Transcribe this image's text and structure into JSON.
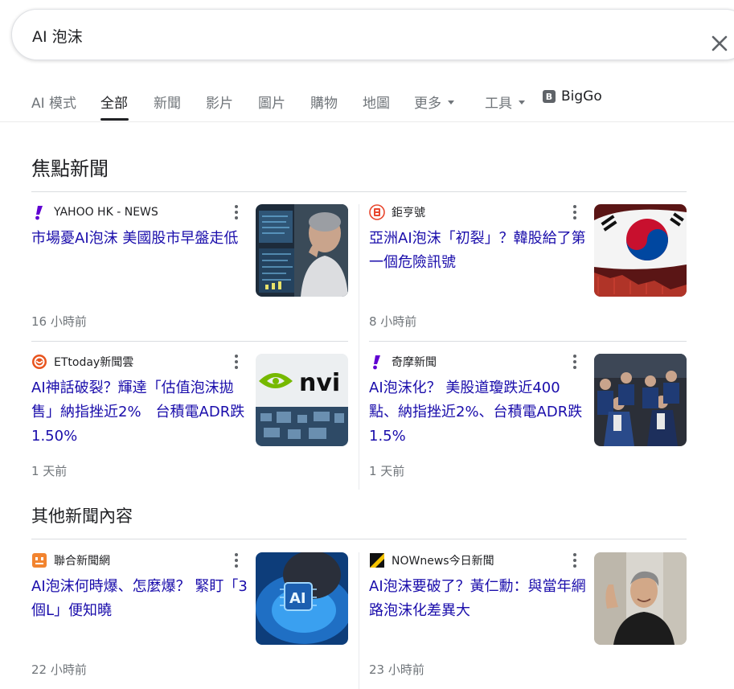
{
  "search": {
    "query": "AI 泡沫"
  },
  "tabs": [
    {
      "label": "AI 模式"
    },
    {
      "label": "全部"
    },
    {
      "label": "新聞"
    },
    {
      "label": "影片"
    },
    {
      "label": "圖片"
    },
    {
      "label": "購物"
    },
    {
      "label": "地圖"
    },
    {
      "label": "更多"
    },
    {
      "label": "工具"
    }
  ],
  "biggo": {
    "icon_letter": "B",
    "label": "BigGo"
  },
  "sections": {
    "top_stories": "焦點新聞",
    "more_news": "其他新聞內容"
  },
  "cards": [
    {
      "source": "YAHOO HK - NEWS",
      "icon": "yahoo-icon",
      "headline": "市場憂AI泡沫 美國股市早盤走低",
      "time": "16 小時前"
    },
    {
      "source": "鉅亨號",
      "icon": "cnyes-icon",
      "headline": "亞洲AI泡沫「初裂」？韓股給了第一個危險訊號",
      "time": "8 小時前"
    },
    {
      "source": "ETtoday新聞雲",
      "icon": "ettoday-icon",
      "headline": "AI神話破裂？輝達「估值泡沫拋售」納指挫近2%　台積電ADR跌1.50%",
      "time": "1 天前"
    },
    {
      "source": "奇摩新聞",
      "icon": "yahoo-icon",
      "headline": "AI泡沫化？ 美股道瓊跌近400點、納指挫近2%、台積電ADR跌1.5%",
      "time": "1 天前"
    },
    {
      "source": "聯合新聞網",
      "icon": "udn-icon",
      "headline": "AI泡沫何時爆、怎麼爆？ 緊盯「3個L」便知曉",
      "time": "22 小時前"
    },
    {
      "source": "NOWnews今日新聞",
      "icon": "nownews-icon",
      "headline": "AI泡沫要破了？黃仁勳：與當年網路泡沫化差異大",
      "time": "23 小時前"
    }
  ],
  "thumb_text": {
    "nvidia": "nvi",
    "ai_chip": "AI"
  },
  "colors": {
    "link": "#1a0dab",
    "muted": "#70757a",
    "yahoo": "#6001d2",
    "ettoday": "#e8541e",
    "udn": "#f2842f"
  }
}
